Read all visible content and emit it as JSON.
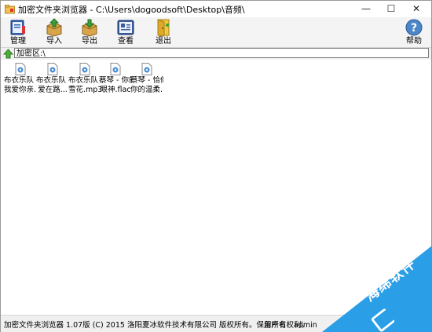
{
  "window": {
    "title": "加密文件夹浏览器 - C:\\Users\\dogoodsoft\\Desktop\\音频\\",
    "minimize": "—",
    "maximize": "☐",
    "close": "✕"
  },
  "toolbar": {
    "manage": "管理",
    "import": "导入",
    "export": "导出",
    "view": "查看",
    "exit": "退出",
    "help": "帮助"
  },
  "address": {
    "path": "加密区:\\"
  },
  "files": [
    {
      "line1": "布衣乐队 -",
      "line2": "我爱你亲..."
    },
    {
      "line1": "布衣乐队 -",
      "line2": "爱在路..."
    },
    {
      "line1": "布衣乐队 -",
      "line2": "雪花.mp3"
    },
    {
      "line1": "蔡琴 - 你的",
      "line2": "眼神.flac"
    },
    {
      "line1": "蔡琴 - 恰似",
      "line2": "你的温柔..."
    }
  ],
  "status": {
    "left": "加密文件夹浏览器 1.07版 (C) 2015 洛阳夏冰软件技术有限公司 版权所有。保留所有权利。",
    "user": "用户名：admin"
  },
  "watermark": {
    "text": "海绵软件"
  },
  "colors": {
    "watermark": "#2b9ee8",
    "toolbar_bg": "#f4f4f4"
  }
}
